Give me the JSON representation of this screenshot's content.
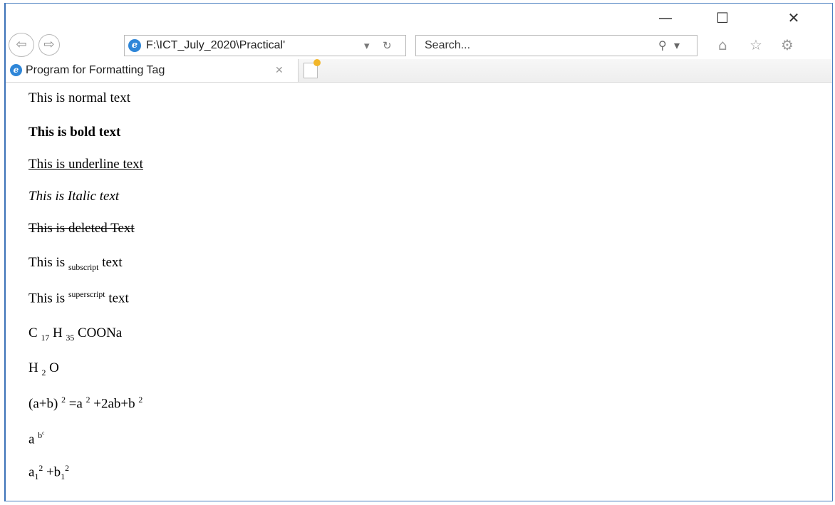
{
  "window": {
    "minimize": "—",
    "maximize": "☐",
    "close": "✕"
  },
  "toolbar": {
    "back": "⇦",
    "forward": "⇨",
    "address": "F:\\ICT_July_2020\\Practical'",
    "address_dropdown": "▾",
    "refresh": "↻",
    "search_value": "Search...",
    "search_icon": "⚲",
    "search_dropdown": "▾",
    "home_icon": "⌂",
    "favorites_icon": "☆",
    "settings_icon": "⚙"
  },
  "tab": {
    "title": "Program for Formatting Tag",
    "close": "✕"
  },
  "content": {
    "normal": "This is normal text",
    "bold": "This is bold text",
    "underline": "This is underline text",
    "italic": "This is Italic text",
    "deleted": "This is deleted Text",
    "sub_prefix": "This is ",
    "sub_word": "subscript",
    "sub_suffix": " text",
    "sup_prefix": "This is ",
    "sup_word": "superscript",
    "sup_suffix": " text",
    "soap": {
      "c": "C ",
      "c_sub": "17",
      "h": " H ",
      "h_sub": "35",
      "rest": " COONa"
    },
    "water": {
      "h": "H ",
      "h_sub": "2",
      "o": " O"
    },
    "formula1": {
      "a": "(a+b) ",
      "s1": "2",
      "b": " =a ",
      "s2": "2",
      "c": " +2ab+b ",
      "s3": "2"
    },
    "formula2": {
      "a": "a ",
      "sup": "b",
      "supsup": "c"
    },
    "formula3": {
      "a": "a",
      "a_sub": "1",
      "s1": "2",
      "b": " +b",
      "b_sub": "1",
      "s2": "2"
    }
  }
}
